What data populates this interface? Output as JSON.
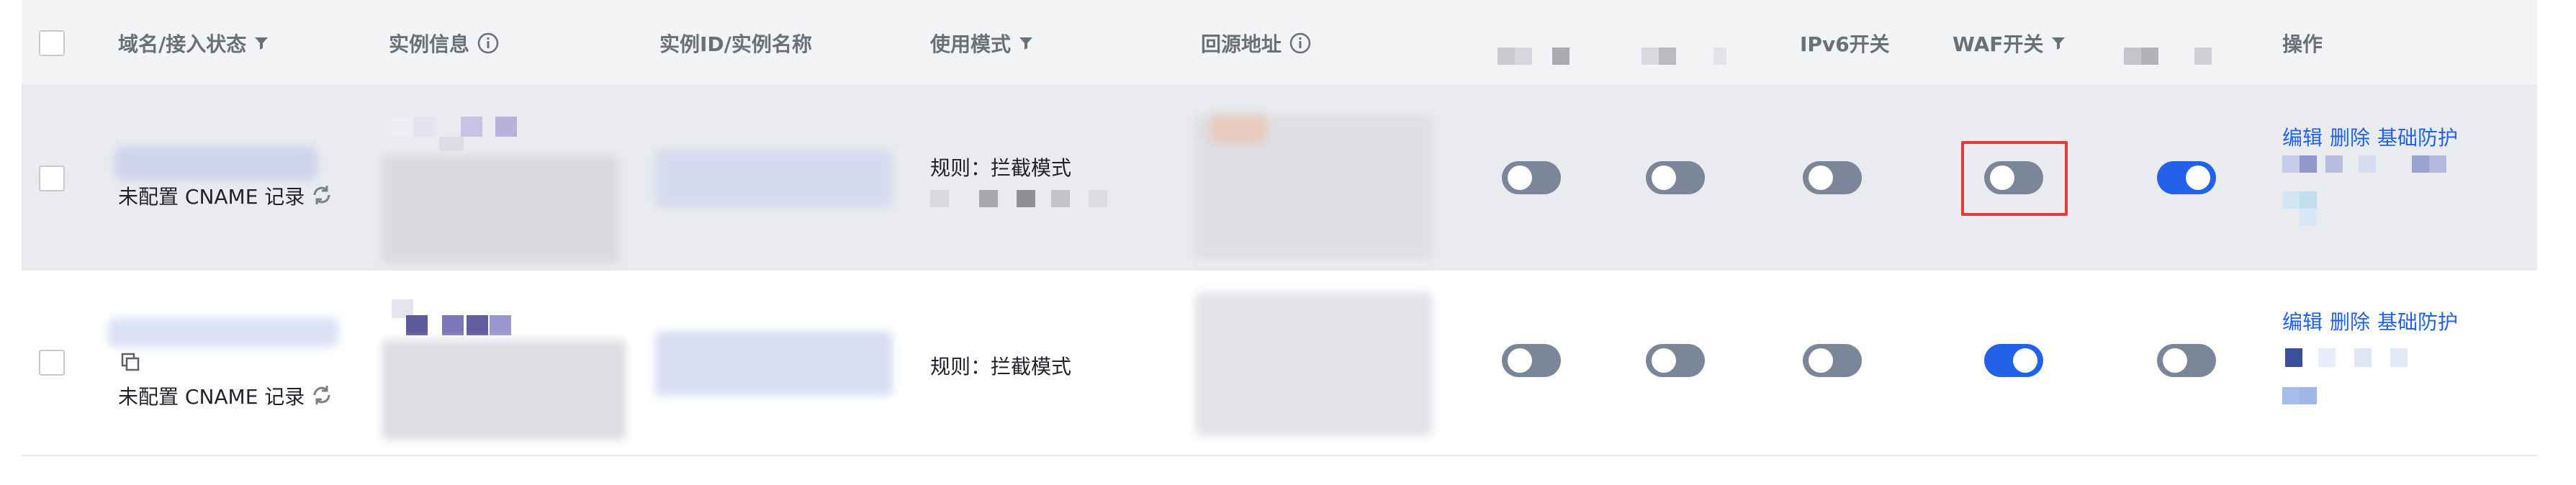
{
  "header": {
    "domain_status": "域名/接入状态",
    "instance_info": "实例信息",
    "instance_id_name": "实例ID/实例名称",
    "usage_mode": "使用模式",
    "origin_address": "回源地址",
    "ipv6_switch": "IPv6开关",
    "waf_switch": "WAF开关",
    "actions": "操作"
  },
  "rows": [
    {
      "status": "未配置 CNAME 记录",
      "mode": "规则：拦截模式",
      "actions": {
        "edit": "编辑",
        "delete": "删除",
        "basic_protection": "基础防护"
      },
      "switches": {
        "col6": false,
        "col7": false,
        "ipv6": false,
        "waf": false,
        "col10": true
      }
    },
    {
      "status": "未配置 CNAME 记录",
      "mode": "规则：拦截模式",
      "actions": {
        "edit": "编辑",
        "delete": "删除",
        "basic_protection": "基础防护"
      },
      "switches": {
        "col6": false,
        "col7": false,
        "ipv6": false,
        "waf": true,
        "col10": false
      }
    }
  ],
  "colors": {
    "accent": "#2162e8",
    "toggle_off": "#7b8699",
    "highlight": "#e53935",
    "header_bg": "#f2f3f5",
    "selected_row_bg": "#e9ebef"
  },
  "icons": {
    "filter": "filter-icon",
    "info": "info-icon",
    "refresh": "refresh-icon",
    "copy": "copy-icon"
  }
}
